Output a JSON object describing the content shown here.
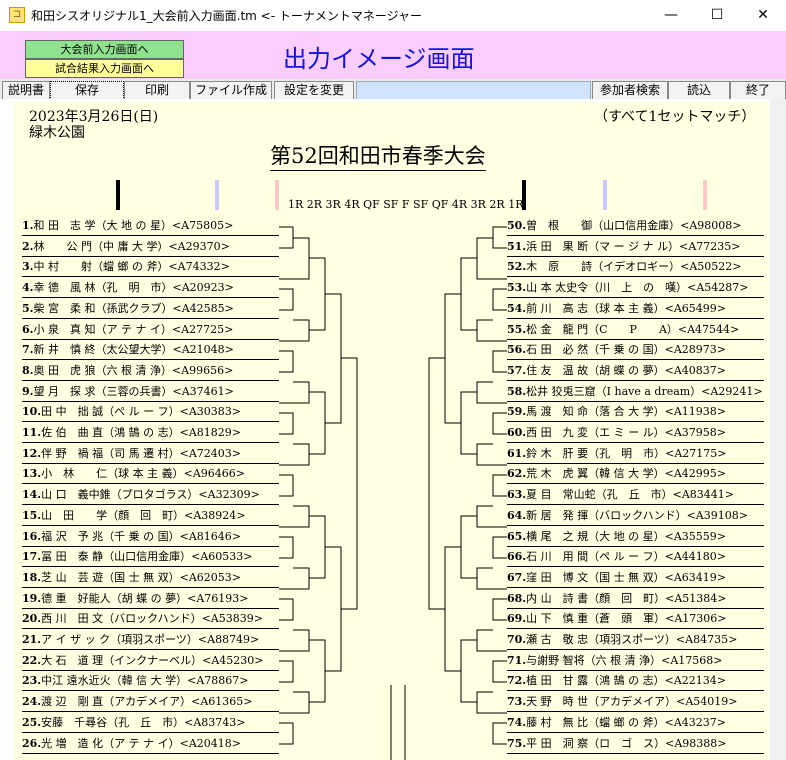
{
  "window": {
    "icon_text": "コ",
    "title": "和田シスオリジナル1_大会前入力画面.tm <- トーナメントマネージャー",
    "minimize": "—",
    "maximize": "☐",
    "close": "✕"
  },
  "header": {
    "nav_pre": "大会前入力画面へ",
    "nav_results": "試合結果入力画面へ",
    "heading": "出力イメージ画面"
  },
  "toolbar": {
    "manual": "説明書",
    "save": "保存",
    "print": "印刷",
    "make_file": "ファイル作成",
    "settings": "設定を変更",
    "search": "参加者検索",
    "load": "読込",
    "exit": "終了"
  },
  "doc": {
    "date": "2023年3月26日(日)",
    "venue": "緑木公園",
    "note": "（すべて1セットマッチ）",
    "tournament": "第52回和田市春季大会",
    "round_labels": "1R 2R 3R 4R QF SF  F  SF QF 4R 3R 2R 1R"
  },
  "colors": {
    "paper": "#ffffe2",
    "header_bg": "#fbcdfd",
    "heading": "#1414d8",
    "nav_green": "#8fe38f",
    "nav_yellow": "#ffff9a",
    "marker_black": "#000000",
    "marker_blue": "#c8c8ff",
    "marker_pink": "#ffc8c8"
  },
  "left_entries": [
    {
      "num": "1.",
      "text": "和 田　志 学（大 地 の 星）<A75805>"
    },
    {
      "num": "2.",
      "text": "林　　公 門（中 庸 大 学）<A29370>"
    },
    {
      "num": "3.",
      "text": "中 村　　射（蟷 螂 の 斧）<A74332>"
    },
    {
      "num": "4.",
      "text": "幸 德　風 林（孔　明　市）<A20923>"
    },
    {
      "num": "5.",
      "text": "柴 宮　柔 和（孫武クラブ）<A42585>"
    },
    {
      "num": "6.",
      "text": "小 泉　真 知（ア テ ナ イ）<A27725>"
    },
    {
      "num": "7.",
      "text": "新 井　慎 終（太公望大学）<A21048>"
    },
    {
      "num": "8.",
      "text": "奥 田　虎 狼（六 根 清 浄）<A99656>"
    },
    {
      "num": "9.",
      "text": "望 月　探 求（三蓉の兵書）<A37461>"
    },
    {
      "num": "10.",
      "text": "田 中　拙 誠（ぺ ル ー フ）<A30383>"
    },
    {
      "num": "11.",
      "text": "佐 伯　曲 直（鴻 鵠 の 志）<A81829>"
    },
    {
      "num": "12.",
      "text": "伴 野　禍 福（司 馬 遷 村）<A72403>"
    },
    {
      "num": "13.",
      "text": "小　林　　仁（球 本 主 義）<A96466>"
    },
    {
      "num": "14.",
      "text": "山 口　義中錐（プロタゴラス）<A32309>"
    },
    {
      "num": "15.",
      "text": "山　田　　学（顔　回　町）<A38924>"
    },
    {
      "num": "16.",
      "text": "福 沢　予 兆（千 乗 の 国）<A81646>"
    },
    {
      "num": "17.",
      "text": "冨 田　泰 静（山口信用金庫）<A60533>"
    },
    {
      "num": "18.",
      "text": "芝 山　芸 遊（国 士 無 双）<A62053>"
    },
    {
      "num": "19.",
      "text": "德 重　好能人（胡 蝶 の 夢）<A76193>"
    },
    {
      "num": "20.",
      "text": "西 川　田 文（バロックハンド）<A53839>"
    },
    {
      "num": "21.",
      "text": "ア イ ザ ッ ク（項羽スポーツ）<A88749>"
    },
    {
      "num": "22.",
      "text": "大 石　道 理（インクナーベル）<A45230>"
    },
    {
      "num": "23.",
      "text": "中江 遠水近火（韓 信 大 学）<A78867>"
    },
    {
      "num": "24.",
      "text": "渡 辺　剛 直（アカデメイア）<A61365>"
    },
    {
      "num": "25.",
      "text": "安藤　千尋谷（孔　丘　市）<A83743>"
    },
    {
      "num": "26.",
      "text": "光 増　造 化（ア テ ナ イ）<A20418>"
    }
  ],
  "right_entries": [
    {
      "num": "50.",
      "text": "曽　根　　御（山口信用金庫）<A98008>"
    },
    {
      "num": "51.",
      "text": "浜 田　果 断（マ ー ジ ナ ル）<A77235>"
    },
    {
      "num": "52.",
      "text": "木　原　　詩（イデオロギー）<A50522>"
    },
    {
      "num": "53.",
      "text": "山 本 太史令（川　上　の　嘆）<A54287>"
    },
    {
      "num": "54.",
      "text": "前 川　高 志（球 本 主 義）<A65499>"
    },
    {
      "num": "55.",
      "text": "松 金　龍 門（C　　P　　A）<A47544>"
    },
    {
      "num": "56.",
      "text": "石 田　必 然（千 乗 の 国）<A28973>"
    },
    {
      "num": "57.",
      "text": "住 友　温 故（胡 蝶 の 夢）<A40837>"
    },
    {
      "num": "58.",
      "text": "松井 狡兎三窟（I have a dream）<A29241>"
    },
    {
      "num": "59.",
      "text": "馬 渡　知 命（落 合 大 学）<A11938>"
    },
    {
      "num": "60.",
      "text": "西 田　九 変（エ ミ ー ル）<A37958>"
    },
    {
      "num": "61.",
      "text": "鈴 木　肝 要（孔　明　市）<A27175>"
    },
    {
      "num": "62.",
      "text": "荒 木　虎 翼（韓 信 大 学）<A42995>"
    },
    {
      "num": "63.",
      "text": "夏 目　常山蛇（孔　丘　市）<A83441>"
    },
    {
      "num": "64.",
      "text": "新 居　発 揮（バロックハンド）<A39108>"
    },
    {
      "num": "65.",
      "text": "横 尾　之 規（大 地 の 星）<A35559>"
    },
    {
      "num": "66.",
      "text": "石 川　用 間（ペ ル ー フ）<A44180>"
    },
    {
      "num": "67.",
      "text": "窪 田　博 文（国 士 無 双）<A63419>"
    },
    {
      "num": "68.",
      "text": "内 山　詩 書（顔　回　町）<A51384>"
    },
    {
      "num": "69.",
      "text": "山 下　慎 重（蒼　頭　軍）<A17306>"
    },
    {
      "num": "70.",
      "text": "瀬 古　敬 忠（項羽スポーツ）<A84735>"
    },
    {
      "num": "71.",
      "text": "与謝野 智将（六 根 清 浄）<A17568>"
    },
    {
      "num": "72.",
      "text": "植 田　甘 露（鴻 鵠 の 志）<A22134>"
    },
    {
      "num": "73.",
      "text": "天 野　時 世（アカデメイア）<A54019>"
    },
    {
      "num": "74.",
      "text": "藤 村　無 比（蟷 螂 の 斧）<A43237>"
    },
    {
      "num": "75.",
      "text": "平 田　洞 察（ロ　ゴ　ス）<A98388>"
    }
  ]
}
